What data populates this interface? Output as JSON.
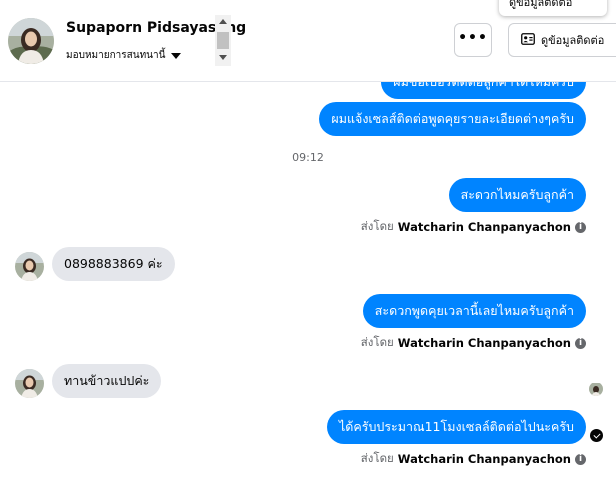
{
  "header": {
    "contact_name": "Supaporn Pidsayasung",
    "assign_label": "มอบหมายการสนทนานี้",
    "more_button_label": "•••",
    "view_contact_label": "ดูข้อมูลติดต่อ",
    "tooltip_label": "ดูข้อมูลติดต่อ"
  },
  "messages": {
    "out_1": "ผมขอเบอร์ติดต่อลูกค้าได้ไหมครับ",
    "out_2": "ผมแจ้งเซลส์ติดต่อพูดคุยรายละเอียดต่างๆครับ",
    "time_1": "09:12",
    "out_3": "สะดวกไหมครับลูกค้า",
    "sent_label_1": "ส่งโดย",
    "agent_1": "Watcharin Chanpanyachon",
    "in_1": "0898883869 ค่ะ",
    "out_4": "สะดวกพูดคุยเวลานี้เลยไหมครับลูกค้า",
    "sent_label_2": "ส่งโดย",
    "agent_2": "Watcharin Chanpanyachon",
    "in_2": "ทานข้าวแปปค่ะ",
    "out_5": "ได้ครับประมาณ11โมงเซลล์ติดต่อไปนะครับ",
    "sent_label_3": "ส่งโดย",
    "agent_3": "Watcharin Chanpanyachon"
  },
  "icons": {
    "info": "i"
  },
  "colors": {
    "outgoing_bubble": "#0084ff",
    "incoming_bubble": "#e4e6eb",
    "secondary_text": "#65676b"
  }
}
